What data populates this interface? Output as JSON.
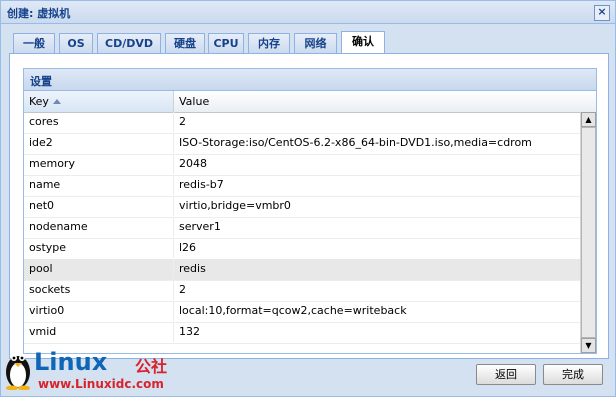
{
  "window": {
    "title": "创建: 虚拟机",
    "close_label": "×"
  },
  "tabs": [
    {
      "label": "一般"
    },
    {
      "label": "OS"
    },
    {
      "label": "CD/DVD"
    },
    {
      "label": "硬盘"
    },
    {
      "label": "CPU"
    },
    {
      "label": "内存"
    },
    {
      "label": "网络"
    },
    {
      "label": "确认"
    }
  ],
  "active_tab": "确认",
  "grid": {
    "title": "设置",
    "columns": {
      "key": "Key",
      "value": "Value"
    },
    "rows": [
      {
        "key": "cores",
        "value": "2"
      },
      {
        "key": "ide2",
        "value": "ISO-Storage:iso/CentOS-6.2-x86_64-bin-DVD1.iso,media=cdrom"
      },
      {
        "key": "memory",
        "value": "2048"
      },
      {
        "key": "name",
        "value": "redis-b7"
      },
      {
        "key": "net0",
        "value": "virtio,bridge=vmbr0"
      },
      {
        "key": "nodename",
        "value": "server1"
      },
      {
        "key": "ostype",
        "value": "l26"
      },
      {
        "key": "pool",
        "value": "redis"
      },
      {
        "key": "sockets",
        "value": "2"
      },
      {
        "key": "virtio0",
        "value": "local:10,format=qcow2,cache=writeback"
      },
      {
        "key": "vmid",
        "value": "132"
      }
    ],
    "selected_row": "pool"
  },
  "footer": {
    "back_label": "返回",
    "finish_label": "完成"
  },
  "watermark": {
    "brand": "Linux",
    "suffix": "公社",
    "url": "www.Linuxidc.com"
  },
  "colors": {
    "header_text": "#15428b",
    "border": "#99bbe8",
    "selected_row": "#e8e8e8"
  }
}
